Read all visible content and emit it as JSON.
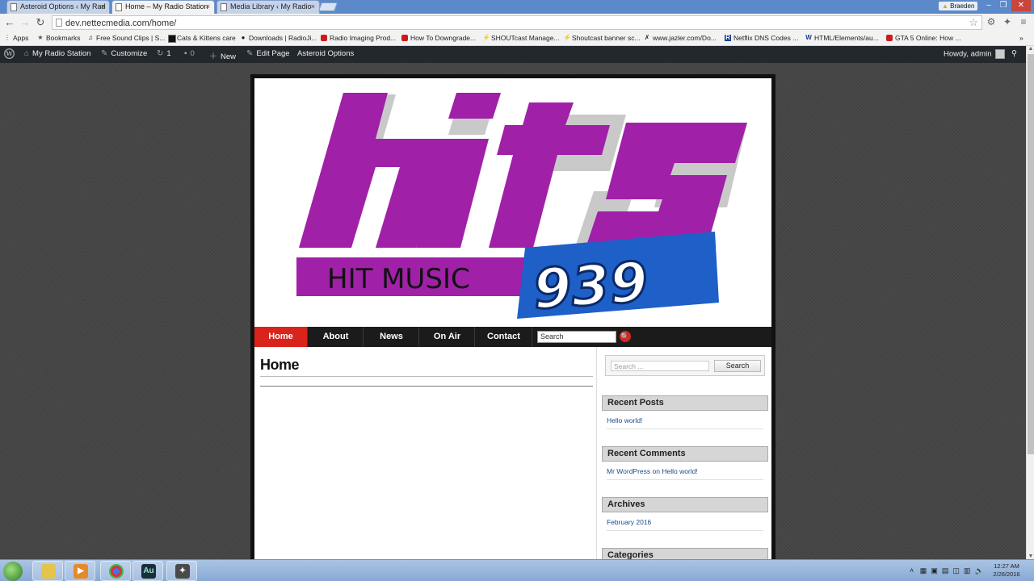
{
  "browser": {
    "tabs": [
      {
        "title": "Asteroid Options ‹ My Rad",
        "active": false
      },
      {
        "title": "Home – My Radio Station",
        "active": true
      },
      {
        "title": "Media Library ‹ My Radio",
        "active": false
      }
    ],
    "tab_close": "×",
    "profile_name": "Braeden",
    "window_controls": [
      "–",
      "❐",
      "✕"
    ],
    "url": "dev.nettecmedia.com/home/",
    "nav_icons": {
      "back": "←",
      "forward": "→",
      "reload": "↻"
    },
    "bookmarks": [
      {
        "label": "Apps",
        "icon": "apps-icon"
      },
      {
        "label": "Bookmarks",
        "icon": "star-icon"
      },
      {
        "label": "Free Sound Clips | S...",
        "icon": "music-icon"
      },
      {
        "label": "Cats & Kittens care",
        "icon": "page-icon"
      },
      {
        "label": "Downloads | RadioJi...",
        "icon": "disc-icon"
      },
      {
        "label": "Radio Imaging Prod...",
        "icon": "youtube-icon"
      },
      {
        "label": "How To Downgrade...",
        "icon": "youtube-icon"
      },
      {
        "label": "SHOUTcast Manage...",
        "icon": "shoutcast-icon"
      },
      {
        "label": "Shoutcast banner sc...",
        "icon": "shoutcast-icon"
      },
      {
        "label": "www.jazler.com/Do...",
        "icon": "jazler-icon"
      },
      {
        "label": "Netflix DNS Codes ...",
        "icon": "r-icon"
      },
      {
        "label": "HTML/Elements/au...",
        "icon": "w3-icon"
      },
      {
        "label": "GTA 5 Online: How ...",
        "icon": "youtube-icon"
      }
    ],
    "bookmarks_overflow": "»"
  },
  "adminbar": {
    "site_name": "My Radio Station",
    "customize": "Customize",
    "updates_count": "1",
    "comments_count": "0",
    "new_label": "New",
    "edit_page": "Edit Page",
    "asteroid_options": "Asteroid Options",
    "howdy": "Howdy, admin"
  },
  "site": {
    "logo": {
      "word": "hits",
      "tagline": "HIT MUSIC",
      "number": "939"
    },
    "colors": {
      "accent": "#d9241c",
      "logo_purple": "#a020a8",
      "logo_blue": "#1f5fc8"
    },
    "nav": [
      "Home",
      "About",
      "News",
      "On Air",
      "Contact"
    ],
    "nav_search_placeholder": "Search",
    "nav_search_icon": "🔍",
    "page_title": "Home",
    "sidebar": {
      "search_placeholder": "Search ...",
      "search_button": "Search",
      "widgets": [
        {
          "title": "Recent Posts",
          "links": [
            "Hello world!"
          ]
        },
        {
          "title": "Recent Comments",
          "links": [
            "Mr WordPress on Hello world!"
          ]
        },
        {
          "title": "Archives",
          "links": [
            "February 2016"
          ]
        },
        {
          "title": "Categories",
          "links": []
        }
      ]
    }
  },
  "taskbar": {
    "apps": [
      {
        "name": "file-explorer",
        "label": ""
      },
      {
        "name": "media-player",
        "label": ""
      },
      {
        "name": "chrome",
        "label": ""
      },
      {
        "name": "audition",
        "label": "Au"
      },
      {
        "name": "network-tool",
        "label": ""
      }
    ],
    "time": "12:27 AM",
    "date": "2/26/2016"
  }
}
